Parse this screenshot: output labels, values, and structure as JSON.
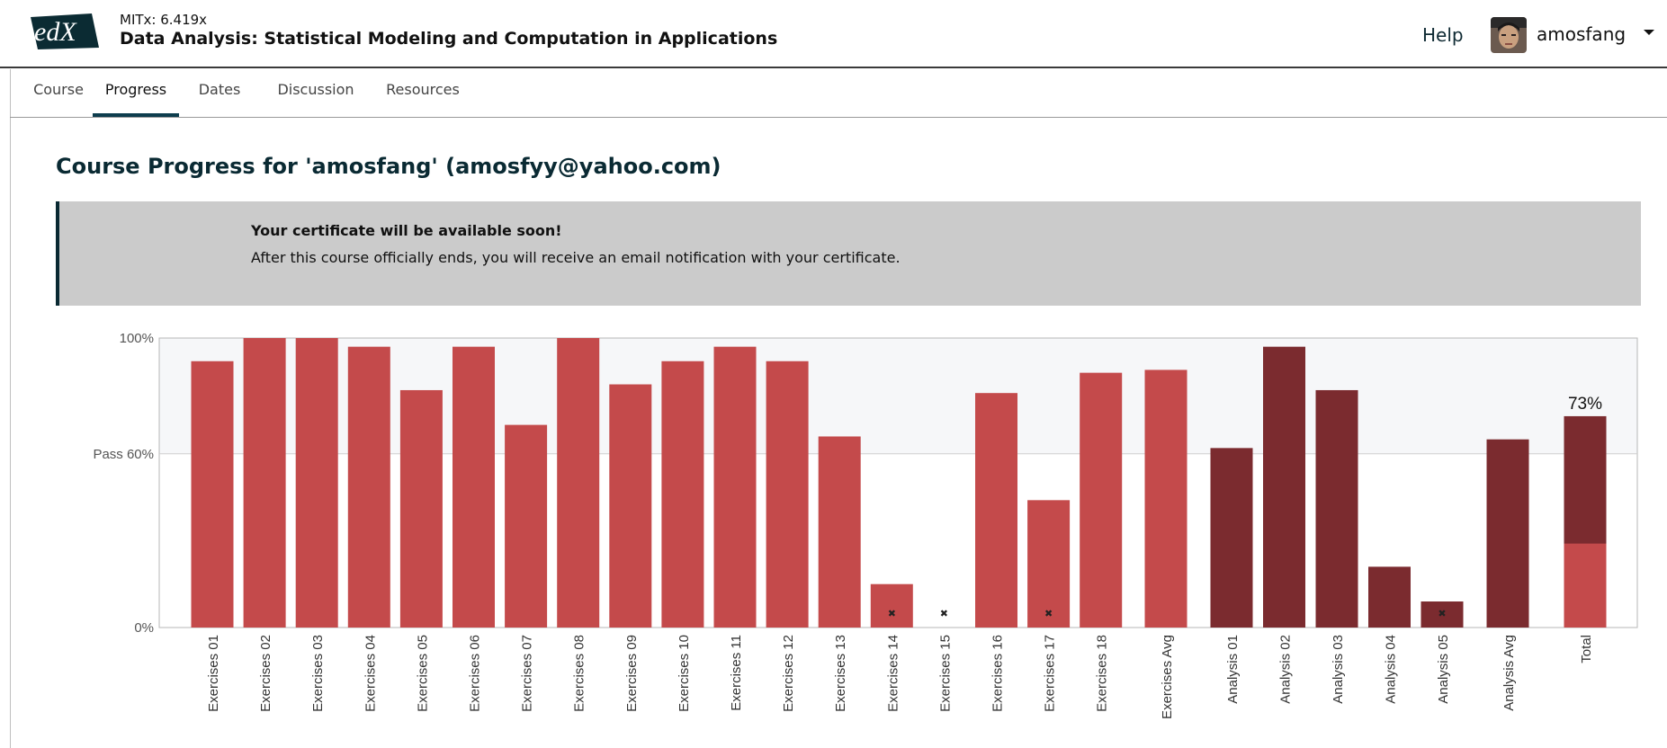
{
  "header": {
    "logo_text": "edX",
    "course_org": "MITx: 6.419x",
    "course_name": "Data Analysis: Statistical Modeling and Computation in Applications",
    "help_label": "Help",
    "username": "amosfang"
  },
  "tabs": [
    {
      "label": "Course"
    },
    {
      "label": "Progress",
      "active": true
    },
    {
      "label": "Dates"
    },
    {
      "label": "Discussion"
    },
    {
      "label": "Resources"
    }
  ],
  "page_title": "Course Progress for 'amosfang' (amosfyy@yahoo.com)",
  "certificate": {
    "title": "Your certificate will be available soon!",
    "body": "After this course officially ends, you will receive an email notification with your certificate."
  },
  "colors": {
    "exercise_bar": "#c44a4b",
    "analysis_bar": "#7b2b2f",
    "accent": "#0d3d4d"
  },
  "chart_data": {
    "type": "bar",
    "ylim": [
      0,
      100
    ],
    "y_ticks": [
      {
        "value": 100,
        "label": "100%"
      },
      {
        "value": 60,
        "label": "Pass 60%"
      },
      {
        "value": 0,
        "label": "0%"
      }
    ],
    "pass_threshold": 60,
    "categories": [
      "Exercises 01",
      "Exercises 02",
      "Exercises 03",
      "Exercises 04",
      "Exercises 05",
      "Exercises 06",
      "Exercises 07",
      "Exercises 08",
      "Exercises 09",
      "Exercises 10",
      "Exercises 11",
      "Exercises 12",
      "Exercises 13",
      "Exercises 14",
      "Exercises 15",
      "Exercises 16",
      "Exercises 17",
      "Exercises 18",
      "Exercises Avg",
      "Analysis 01",
      "Analysis 02",
      "Analysis 03",
      "Analysis 04",
      "Analysis 05",
      "Analysis Avg",
      "Total"
    ],
    "values": [
      92,
      100,
      100,
      97,
      82,
      97,
      70,
      100,
      84,
      92,
      97,
      92,
      66,
      15,
      0,
      81,
      44,
      88,
      89,
      62,
      97,
      82,
      21,
      9,
      65,
      73
    ],
    "groups": [
      "exercise",
      "exercise",
      "exercise",
      "exercise",
      "exercise",
      "exercise",
      "exercise",
      "exercise",
      "exercise",
      "exercise",
      "exercise",
      "exercise",
      "exercise",
      "exercise",
      "exercise",
      "exercise",
      "exercise",
      "exercise",
      "exercise",
      "analysis",
      "analysis",
      "analysis",
      "analysis",
      "analysis",
      "analysis",
      "total"
    ],
    "dropped": [
      "Exercises 14",
      "Exercises 15",
      "Exercises 17",
      "Analysis 05"
    ],
    "dropped_marker": "✖",
    "total": {
      "value": 73,
      "label": "73%",
      "exercise_part": 29
    }
  }
}
